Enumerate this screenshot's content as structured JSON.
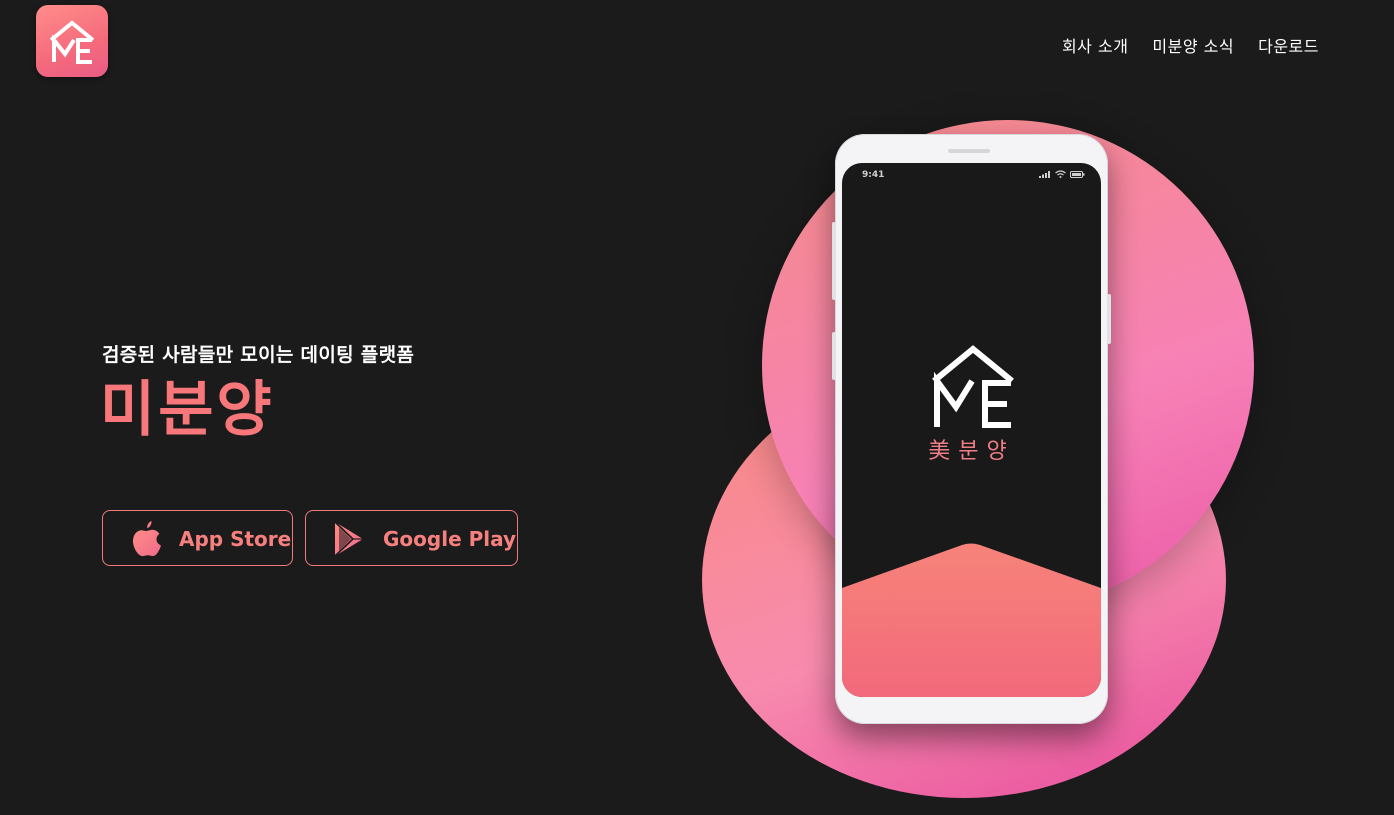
{
  "logo": {
    "icon": "me-house-logo-icon",
    "text": "ME"
  },
  "nav": {
    "items": [
      {
        "label": "회사 소개"
      },
      {
        "label": "미분양 소식"
      },
      {
        "label": "다운로드"
      }
    ]
  },
  "hero": {
    "tagline": "검증된 사람들만 모이는 데이팅 플랫폼",
    "title": "미분양"
  },
  "downloads": {
    "app_store": {
      "label": "App Store",
      "icon": "apple-icon"
    },
    "google_play": {
      "label": "Google Play",
      "icon": "google-play-icon"
    }
  },
  "phone": {
    "status_time": "9:41",
    "screen_logo": "ME",
    "screen_brand": "美분양"
  },
  "colors": {
    "background": "#1b1b1c",
    "accent": "#f7777a",
    "pink": "#f781b6"
  }
}
